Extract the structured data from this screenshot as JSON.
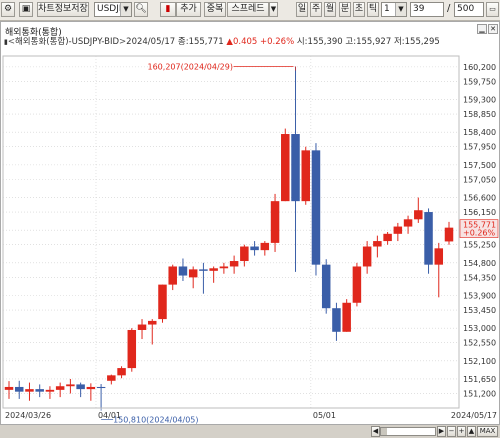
{
  "toolbar": {
    "settings_icon": "gear-icon",
    "chart_save_label": "차트정보저장",
    "symbol_value": "USDJPY",
    "search_icon": "magnifier-icon",
    "chart_type_icon": "candlestick-icon",
    "add_label": "추가",
    "overlap_label": "중복",
    "spread_label": "스프레드",
    "periods": [
      "일",
      "주",
      "월",
      "분",
      "초",
      "틱"
    ],
    "interval_value": "1",
    "count_value": "39",
    "slash": "/",
    "total_value": "500"
  },
  "panel": {
    "title": "해외통화(통합)",
    "legend_name": "해외통화(통합)-USDJPY-BID",
    "legend_period": "(일)",
    "legend_date": "2024/05/17",
    "legend_close_label": "종:",
    "legend_close": "155,771",
    "legend_change": "0.405",
    "legend_pct": "+0.26%",
    "legend_open_label": "시:",
    "legend_open": "155,390",
    "legend_high_label": "고:",
    "legend_high": "155,927",
    "legend_low_label": "저:",
    "legend_low": "155,295",
    "max_label": "MAX"
  },
  "chart_data": {
    "type": "candlestick",
    "x_labels": [
      "2024/03/26",
      "04/01",
      "05/01",
      "2024/05/17"
    ],
    "y_ticks": [
      151.2,
      151.6,
      152.1,
      152.6,
      153.0,
      153.5,
      153.9,
      154.4,
      154.8,
      155.3,
      155.7,
      156.2,
      156.6,
      157.1,
      157.5,
      158.0,
      158.4,
      158.9,
      159.3,
      159.8,
      160.2
    ],
    "y_tick_labels": [
      "151,200",
      "151,650",
      "152,100",
      "152,550",
      "153,000",
      "153,450",
      "153,900",
      "154,350",
      "154,800",
      "155,250",
      "155,700",
      "156,150",
      "156,600",
      "157,050",
      "157,500",
      "157,950",
      "158,400",
      "158,850",
      "159,300",
      "159,750",
      "160,200"
    ],
    "ylim": [
      150.8,
      160.5
    ],
    "high_annotation": "160,207(2024/04/29)",
    "low_annotation": "150,810(2024/04/05)",
    "last_price": "155,771",
    "last_change_pct": "+0.26%",
    "colors": {
      "up": "#e0271c",
      "down": "#3a5ea8",
      "grid": "#cfcfcf"
    },
    "candles": [
      {
        "o": 151.3,
        "h": 151.54,
        "l": 151.05,
        "c": 151.38
      },
      {
        "o": 151.38,
        "h": 151.55,
        "l": 151.05,
        "c": 151.25
      },
      {
        "o": 151.25,
        "h": 151.5,
        "l": 151.0,
        "c": 151.32
      },
      {
        "o": 151.32,
        "h": 151.45,
        "l": 151.1,
        "c": 151.25
      },
      {
        "o": 151.25,
        "h": 151.4,
        "l": 151.05,
        "c": 151.3
      },
      {
        "o": 151.3,
        "h": 151.5,
        "l": 151.1,
        "c": 151.4
      },
      {
        "o": 151.4,
        "h": 151.6,
        "l": 151.2,
        "c": 151.45
      },
      {
        "o": 151.45,
        "h": 151.5,
        "l": 151.1,
        "c": 151.32
      },
      {
        "o": 151.32,
        "h": 151.48,
        "l": 151.0,
        "c": 151.38
      },
      {
        "o": 151.38,
        "h": 151.46,
        "l": 150.81,
        "c": 151.35
      },
      {
        "o": 151.55,
        "h": 151.72,
        "l": 151.45,
        "c": 151.7
      },
      {
        "o": 151.7,
        "h": 151.95,
        "l": 151.62,
        "c": 151.9
      },
      {
        "o": 151.9,
        "h": 153.0,
        "l": 151.8,
        "c": 152.95
      },
      {
        "o": 152.95,
        "h": 153.25,
        "l": 152.7,
        "c": 153.1
      },
      {
        "o": 153.1,
        "h": 153.25,
        "l": 152.55,
        "c": 153.2
      },
      {
        "o": 153.25,
        "h": 154.2,
        "l": 153.15,
        "c": 154.2
      },
      {
        "o": 154.2,
        "h": 154.75,
        "l": 154.05,
        "c": 154.7
      },
      {
        "o": 154.7,
        "h": 154.92,
        "l": 154.3,
        "c": 154.45
      },
      {
        "o": 154.4,
        "h": 154.7,
        "l": 154.1,
        "c": 154.62
      },
      {
        "o": 154.62,
        "h": 154.8,
        "l": 153.95,
        "c": 154.58
      },
      {
        "o": 154.58,
        "h": 154.7,
        "l": 154.25,
        "c": 154.65
      },
      {
        "o": 154.65,
        "h": 154.8,
        "l": 154.5,
        "c": 154.7
      },
      {
        "o": 154.7,
        "h": 155.0,
        "l": 154.5,
        "c": 154.85
      },
      {
        "o": 154.85,
        "h": 155.3,
        "l": 154.7,
        "c": 155.25
      },
      {
        "o": 155.25,
        "h": 155.4,
        "l": 155.0,
        "c": 155.15
      },
      {
        "o": 155.15,
        "h": 155.4,
        "l": 155.0,
        "c": 155.35
      },
      {
        "o": 155.35,
        "h": 156.7,
        "l": 155.1,
        "c": 156.5
      },
      {
        "o": 156.5,
        "h": 158.5,
        "l": 156.5,
        "c": 158.35
      },
      {
        "o": 158.35,
        "h": 160.21,
        "l": 154.55,
        "c": 156.5
      },
      {
        "o": 156.5,
        "h": 158.0,
        "l": 156.4,
        "c": 157.9
      },
      {
        "o": 157.9,
        "h": 158.1,
        "l": 154.45,
        "c": 154.75
      },
      {
        "o": 154.75,
        "h": 154.9,
        "l": 153.4,
        "c": 153.55
      },
      {
        "o": 153.55,
        "h": 153.7,
        "l": 152.65,
        "c": 152.9
      },
      {
        "o": 152.9,
        "h": 153.8,
        "l": 152.9,
        "c": 153.7
      },
      {
        "o": 153.7,
        "h": 154.8,
        "l": 153.6,
        "c": 154.7
      },
      {
        "o": 154.7,
        "h": 155.4,
        "l": 154.5,
        "c": 155.25
      },
      {
        "o": 155.25,
        "h": 155.55,
        "l": 154.95,
        "c": 155.4
      },
      {
        "o": 155.4,
        "h": 155.65,
        "l": 155.3,
        "c": 155.6
      },
      {
        "o": 155.6,
        "h": 155.9,
        "l": 155.4,
        "c": 155.8
      },
      {
        "o": 155.8,
        "h": 156.1,
        "l": 155.6,
        "c": 156.0
      },
      {
        "o": 156.0,
        "h": 156.6,
        "l": 155.9,
        "c": 156.25
      },
      {
        "o": 156.2,
        "h": 156.3,
        "l": 154.5,
        "c": 154.75
      },
      {
        "o": 154.75,
        "h": 155.35,
        "l": 153.85,
        "c": 155.2
      },
      {
        "o": 155.39,
        "h": 155.93,
        "l": 155.3,
        "c": 155.77
      }
    ]
  },
  "bottombar": {
    "buttons": [
      "◀",
      "▶",
      "−",
      "+",
      "▲",
      "MAX"
    ]
  }
}
